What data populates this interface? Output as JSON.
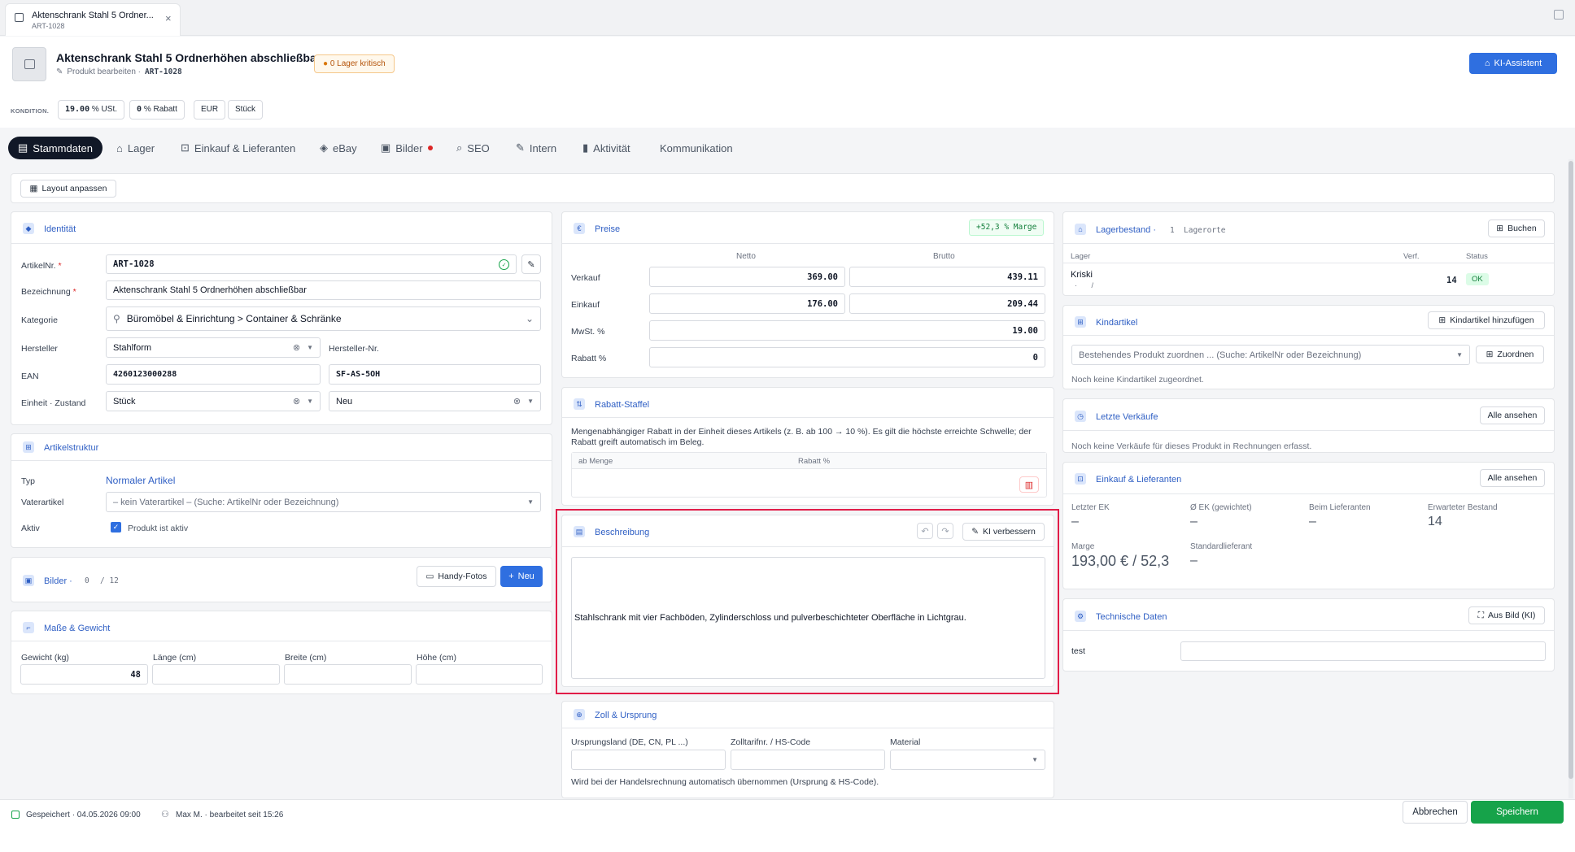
{
  "window": {
    "tab_title": "Aktenschrank Stahl 5 Ordner...",
    "tab_sub": "ART-1028"
  },
  "header": {
    "title": "Aktenschrank Stahl 5 Ordnerhöhen abschließbar",
    "subtitle": "Produkt bearbeiten ·",
    "art_no": "ART-1028",
    "warn_count": "0",
    "warn_text": "Lager kritisch",
    "ai_button": "KI-Assistent"
  },
  "conditions": {
    "label": "KONDITION.",
    "vat": "19.00",
    "vat_unit": "% USt.",
    "discount": "0",
    "discount_unit": "% Rabatt",
    "currency": "EUR",
    "unit": "Stück"
  },
  "tabs": [
    {
      "label": "Stammdaten"
    },
    {
      "label": "Lager"
    },
    {
      "label": "Einkauf & Lieferanten"
    },
    {
      "label": "eBay"
    },
    {
      "label": "Bilder"
    },
    {
      "label": "SEO"
    },
    {
      "label": "Intern"
    },
    {
      "label": "Aktivität"
    },
    {
      "label": "Kommunikation"
    }
  ],
  "layout_button": "Layout anpassen",
  "identity": {
    "title": "Identität",
    "artno_label": "ArtikelNr.",
    "artno_value": "ART-1028",
    "name_label": "Bezeichnung",
    "name_value": "Aktenschrank Stahl 5 Ordnerhöhen abschließbar",
    "category_label": "Kategorie",
    "category_value": "Büromöbel & Einrichtung > Container & Schränke",
    "maker_label": "Hersteller",
    "maker_value": "Stahlform",
    "maker_no_label": "Hersteller-Nr.",
    "ean_label": "EAN",
    "ean_value": "4260123000288",
    "maker_no_value": "SF-AS-5OH",
    "unit_label": "Einheit · Zustand",
    "unit_value": "Stück",
    "condition_value": "Neu"
  },
  "structure": {
    "title": "Artikelstruktur",
    "type_label": "Typ",
    "type_value": "Normaler Artikel",
    "parent_label": "Vaterartikel",
    "parent_placeholder": "– kein Vaterartikel – (Suche: ArtikelNr oder Bezeichnung)",
    "active_label": "Aktiv",
    "active_text": "Produkt ist aktiv"
  },
  "images": {
    "title": "Bilder ·",
    "count": "0",
    "max": "/ 12",
    "phone_btn": "Handy-Fotos",
    "new_btn": "Neu"
  },
  "dimensions": {
    "title": "Maße & Gewicht",
    "weight_label": "Gewicht (kg)",
    "weight_value": "48",
    "length_label": "Länge (cm)",
    "width_label": "Breite (cm)",
    "height_label": "Höhe (cm)"
  },
  "prices": {
    "title": "Preise",
    "margin_badge": "+52,3 % Marge",
    "col_net": "Netto",
    "col_gross": "Brutto",
    "sell_label": "Verkauf",
    "sell_net": "369.00",
    "sell_gross": "439.11",
    "buy_label": "Einkauf",
    "buy_net": "176.00",
    "buy_gross": "209.44",
    "vat_label": "MwSt. %",
    "vat_value": "19.00",
    "discount_label": "Rabatt %",
    "discount_value": "0"
  },
  "discount_scale": {
    "title": "Rabatt-Staffel",
    "desc": "Mengenabhängiger Rabatt in der Einheit dieses Artikels (z. B. ab 100 → 10 %). Es gilt die höchste erreichte Schwelle; der Rabatt greift automatisch im Beleg.",
    "col_qty": "ab Menge",
    "col_pct": "Rabatt %"
  },
  "description": {
    "title": "Beschreibung",
    "ai_btn": "KI verbessern",
    "text": "Stahlschrank mit vier Fachböden, Zylinderschloss und pulverbeschichteter Oberfläche in Lichtgrau."
  },
  "customs": {
    "title": "Zoll & Ursprung",
    "origin_label": "Ursprungsland (DE, CN, PL ...)",
    "hs_label": "Zolltarifnr. / HS-Code",
    "material_label": "Material",
    "note": "Wird bei der Handelsrechnung automatisch übernommen (Ursprung & HS-Code)."
  },
  "stock": {
    "title": "Lagerbestand ·",
    "count": "1",
    "count_label": "Lagerorte",
    "book_btn": "Buchen",
    "col_lager": "Lager",
    "col_avail": "Verf.",
    "col_status": "Status",
    "row_name": "Kriski",
    "row_sub": "·       /",
    "row_qty": "14",
    "row_status": "OK"
  },
  "children": {
    "title": "Kindartikel",
    "add_btn": "Kindartikel hinzufügen",
    "placeholder": "Bestehendes Produkt zuordnen ... (Suche: ArtikelNr oder Bezeichnung)",
    "assign_btn": "Zuordnen",
    "empty": "Noch keine Kindartikel zugeordnet."
  },
  "sales": {
    "title": "Letzte Verkäufe",
    "all_btn": "Alle ansehen",
    "empty": "Noch keine Verkäufe für dieses Produkt in Rechnungen erfasst."
  },
  "purchase": {
    "title": "Einkauf & Lieferanten",
    "all_btn": "Alle ansehen",
    "last_ek_label": "Letzter EK",
    "last_ek": "–",
    "avg_ek_label": "Ø EK (gewichtet)",
    "avg_ek": "–",
    "supplier_label": "Beim Lieferanten",
    "supplier": "–",
    "expected_label": "Erwarteter Bestand",
    "expected": "14",
    "margin_label": "Marge",
    "margin": "193,00 € / 52,3",
    "std_label": "Standardlieferant",
    "std": "–"
  },
  "tech": {
    "title": "Technische Daten",
    "from_image_btn": "Aus Bild (KI)",
    "row_label": "test"
  },
  "footer": {
    "saved": "Gespeichert · 04.05.2026 09:00",
    "user": "Max M. · bearbeitet seit 15:26",
    "cancel": "Abbrechen",
    "save": "Speichern"
  },
  "colors": {
    "accent": "#2f6fe0",
    "save": "#16a34a",
    "highlight": "#e11d48",
    "title_blue": "#2f5fc4"
  }
}
